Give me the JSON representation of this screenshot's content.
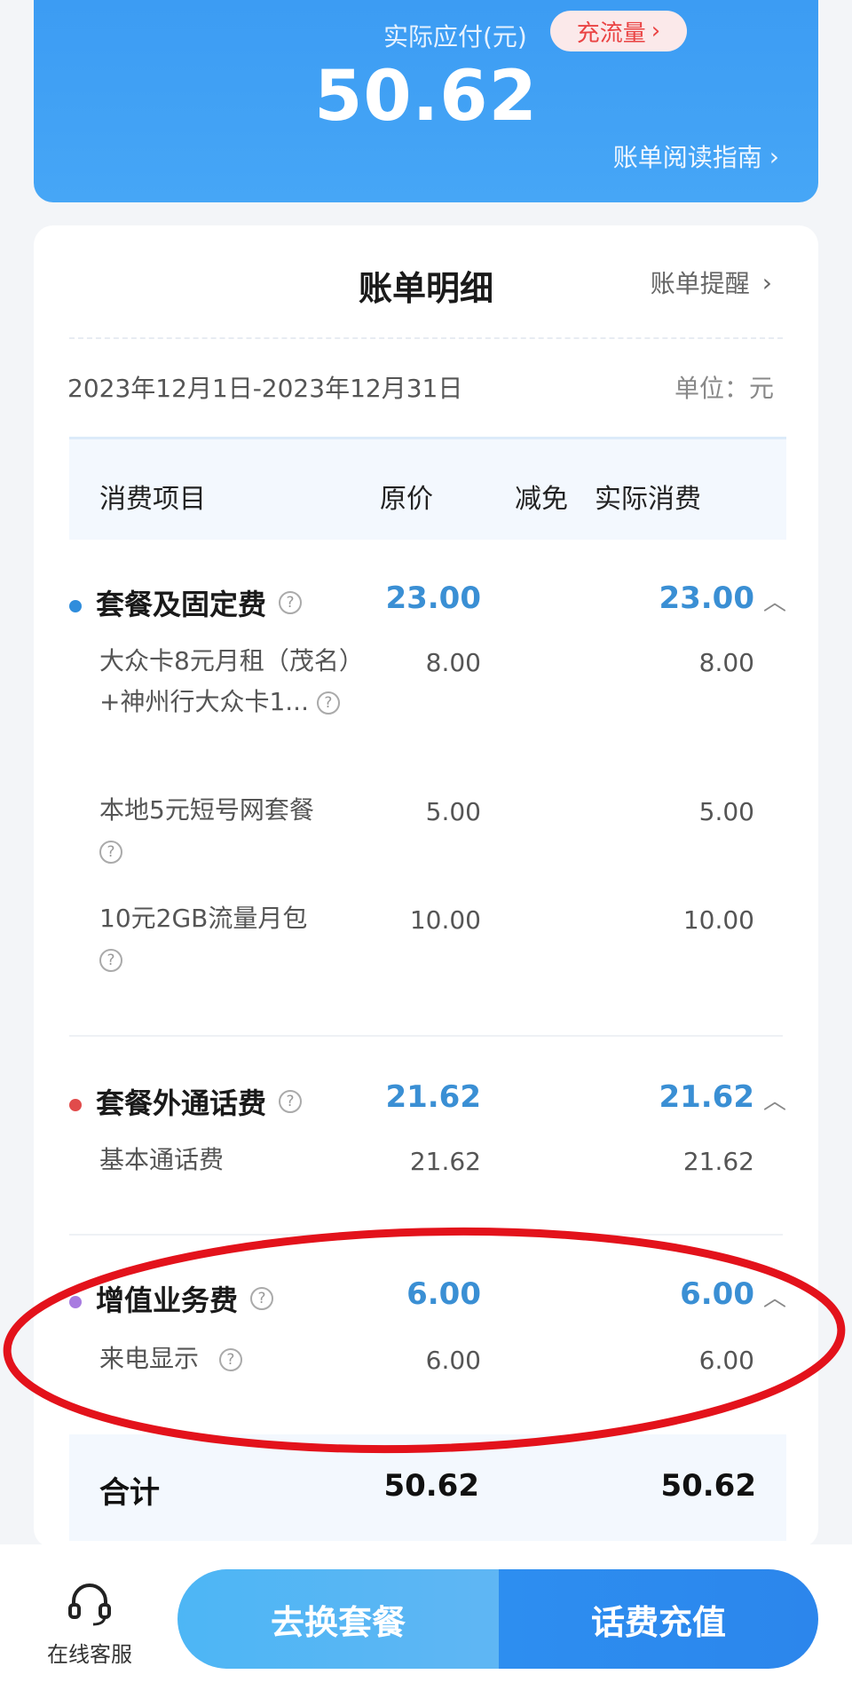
{
  "header": {
    "amount_label": "实际应付(元)",
    "promo_label": "充流量",
    "amount": "50.62",
    "guide_label": "账单阅读指南"
  },
  "detail": {
    "title": "账单明细",
    "reminder_label": "账单提醒",
    "period": "2023年12月1日-2023年12月31日",
    "unit": "单位：元",
    "columns": {
      "item": "消费项目",
      "original": "原价",
      "discount": "减免",
      "actual": "实际消费"
    },
    "sections": [
      {
        "name": "套餐及固定费",
        "original": "23.00",
        "actual": "23.00",
        "dot_color": "#2f8ddc",
        "items": [
          {
            "name": "大众卡8元月租（茂名）+神州行大众卡1...",
            "original": "8.00",
            "actual": "8.00"
          },
          {
            "name": "本地5元短号网套餐",
            "original": "5.00",
            "actual": "5.00"
          },
          {
            "name": "10元2GB流量月包",
            "original": "10.00",
            "actual": "10.00"
          }
        ]
      },
      {
        "name": "套餐外通话费",
        "original": "21.62",
        "actual": "21.62",
        "dot_color": "#e14b4b",
        "items": [
          {
            "name": "基本通话费",
            "original": "21.62",
            "actual": "21.62"
          }
        ]
      },
      {
        "name": "增值业务费",
        "original": "6.00",
        "actual": "6.00",
        "dot_color": "#a87be0",
        "items": [
          {
            "name": "来电显示",
            "original": "6.00",
            "actual": "6.00"
          }
        ]
      }
    ],
    "total": {
      "label": "合计",
      "original": "50.62",
      "actual": "50.62"
    }
  },
  "bottom": {
    "service_label": "在线客服",
    "switch_plan_label": "去换套餐",
    "recharge_label": "话费充值"
  },
  "colors": {
    "accent_blue": "#3a8fd4",
    "annotation_red": "#e3121b"
  },
  "icons": {
    "service": "headset-icon",
    "help": "question-circle-icon",
    "chevron": "chevron-right-icon",
    "collapse": "chevron-up-icon"
  }
}
